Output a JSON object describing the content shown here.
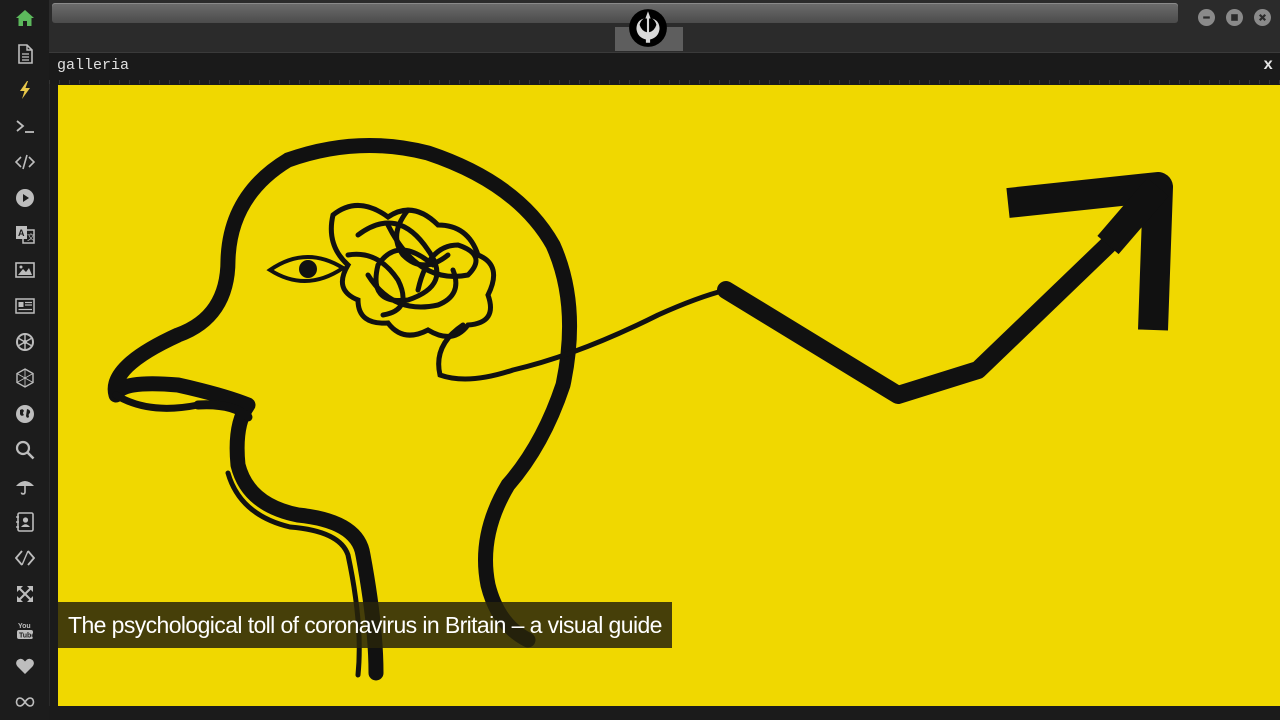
{
  "panel": {
    "title": "galleria",
    "close_label": "x"
  },
  "gallery": {
    "caption": "The psychological toll of coronavirus in Britain – a visual guide"
  },
  "sidebar": {
    "items": [
      {
        "icon": "home-icon",
        "active": true
      },
      {
        "icon": "document-icon"
      },
      {
        "icon": "lightning-icon"
      },
      {
        "icon": "terminal-icon"
      },
      {
        "icon": "code-icon"
      },
      {
        "icon": "play-icon"
      },
      {
        "icon": "translate-icon"
      },
      {
        "icon": "image-icon"
      },
      {
        "icon": "news-icon"
      },
      {
        "icon": "settings-wheel-icon"
      },
      {
        "icon": "network-icon"
      },
      {
        "icon": "globe-icon"
      },
      {
        "icon": "search-icon"
      },
      {
        "icon": "umbrella-icon"
      },
      {
        "icon": "contacts-icon"
      },
      {
        "icon": "diamond-code-icon"
      },
      {
        "icon": "expand-icon"
      },
      {
        "icon": "youtube-icon"
      },
      {
        "icon": "heart-icon"
      },
      {
        "icon": "infinity-icon"
      }
    ]
  },
  "colors": {
    "accent_green": "#5cb85c",
    "lightning_yellow": "#e8c84a",
    "image_yellow": "#f0d800",
    "icon_gray": "#bdbdbd"
  }
}
